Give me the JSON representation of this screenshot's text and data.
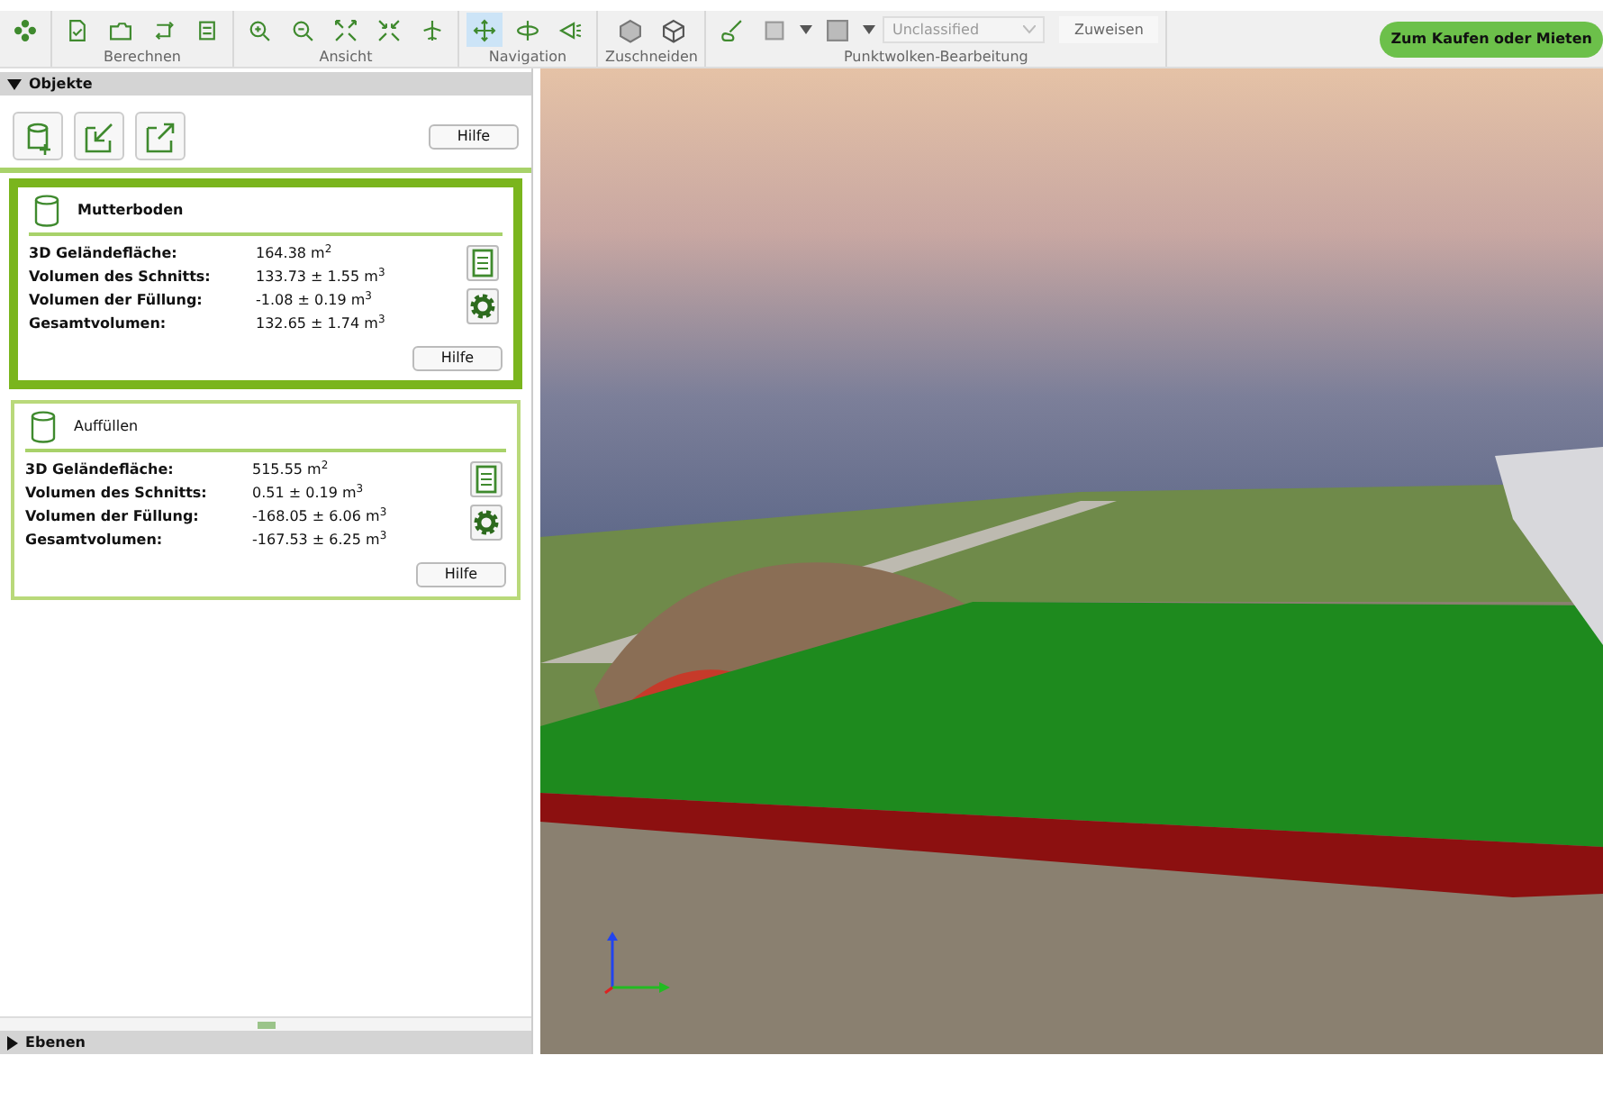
{
  "toolbar": {
    "groups": [
      {
        "buttons": [
          {
            "selected": false
          }
        ]
      },
      {
        "label": "Berechnen",
        "buttons": [
          {
            "selected": false
          },
          {
            "selected": false
          },
          {
            "selected": false
          },
          {
            "selected": false
          }
        ]
      },
      {
        "label": "Ansicht",
        "buttons": [
          {
            "selected": false
          },
          {
            "selected": false
          },
          {
            "selected": false
          },
          {
            "selected": false
          },
          {
            "selected": false
          }
        ]
      },
      {
        "label": "Navigation",
        "buttons": [
          {
            "selected": true
          },
          {
            "selected": false
          },
          {
            "selected": false
          }
        ]
      },
      {
        "label": "Zuschneiden",
        "buttons": [
          {
            "selected": false
          },
          {
            "selected": false
          }
        ]
      },
      {
        "label": "Punktwolken-Bearbeitung",
        "buttons": [
          {
            "selected": false
          },
          {
            "selected": false
          },
          {
            "selected": false
          }
        ]
      }
    ],
    "class_select": {
      "value": "Unclassified",
      "disabled": true
    },
    "assign_button": "Zuweisen",
    "buy_button": "Zum Kaufen oder Mieten"
  },
  "objects_panel": {
    "title": "Objekte",
    "expanded": true,
    "help_button": "Hilfe",
    "items": [
      {
        "name": "Mutterboden",
        "selected": true,
        "rows": [
          {
            "label": "3D Geländefläche:",
            "value": "164.38  m$^{2}$"
          },
          {
            "label": "Volumen des Schnitts:",
            "value": "133.73  ± 1.55  m$^{3}$"
          },
          {
            "label": "Volumen der Füllung:",
            "value": "-1.08  ± 0.19  m$^{3}$"
          },
          {
            "label": "Gesamtvolumen:",
            "value": "132.65  ± 1.74  m$^{3}$"
          }
        ],
        "help_button": "Hilfe"
      },
      {
        "name": "Auffüllen",
        "selected": false,
        "rows": [
          {
            "label": "3D Geländefläche:",
            "value": "515.55  m$^{2}$"
          },
          {
            "label": "Volumen des Schnitts:",
            "value": "0.51  ± 0.19  m$^{3}$"
          },
          {
            "label": "Volumen der Füllung:",
            "value": "-168.05  ± 6.06  m$^{3}$"
          },
          {
            "label": "Gesamtvolumen:",
            "value": "-167.53  ± 6.25  m$^{3}$"
          }
        ],
        "help_button": "Hilfe"
      }
    ]
  },
  "layers_panel": {
    "title": "Ebenen",
    "expanded": false
  }
}
